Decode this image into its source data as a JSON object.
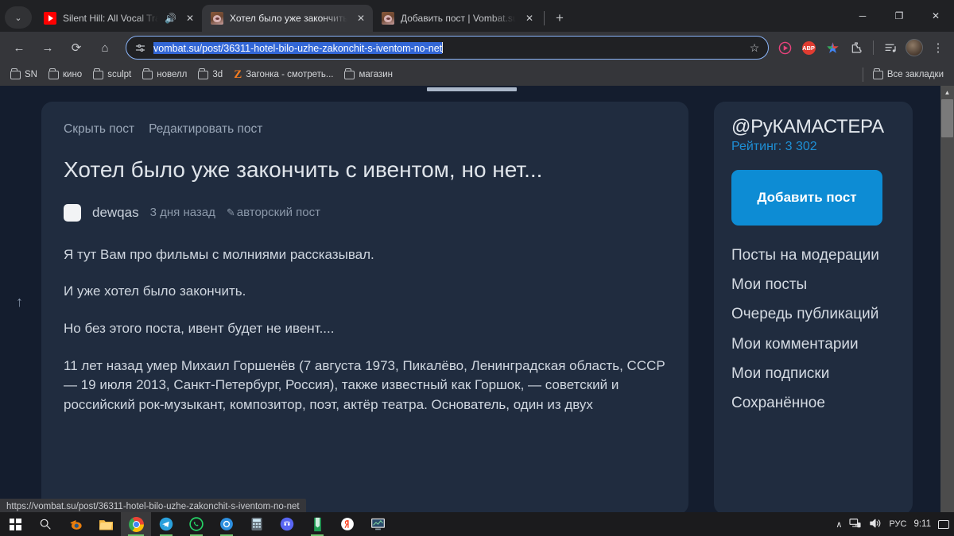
{
  "browser": {
    "tabs": [
      {
        "title": "Silent Hill: All Vocal Tracks -",
        "favicon": "youtube-icon",
        "audio": "audio-playing-icon",
        "active": false
      },
      {
        "title": "Хотел было уже закончить с и",
        "favicon": "vombat-icon",
        "audio": "",
        "active": true
      },
      {
        "title": "Добавить пост | Vombat.su",
        "favicon": "vombat-icon",
        "audio": "",
        "active": false
      }
    ],
    "new_tab_label": "+",
    "tab_close_label": "✕",
    "tab_list_chevron": "⌄",
    "window_controls": {
      "minimize": "─",
      "maximize": "❐",
      "close": "✕"
    },
    "nav": {
      "back": "←",
      "forward": "→",
      "reload": "⟳",
      "home": "⌂"
    },
    "omnibox": {
      "site_settings_icon": "tune-icon",
      "url_selected": "vombat.su/post/36311-hotel-bilo-uzhe-zakonchit-s-iventom-no-net",
      "bookmark_star": "☆"
    },
    "extensions": [
      {
        "name": "video-downloader-icon",
        "label": "▶"
      },
      {
        "name": "adblock-plus-icon",
        "label": "ABP"
      },
      {
        "name": "colorful-star-icon",
        "label": "✦"
      },
      {
        "name": "extensions-puzzle-icon",
        "label": "⧉"
      },
      {
        "name": "reading-list-icon",
        "label": "☰♪"
      }
    ],
    "profile_label": "",
    "menu_label": "⋮",
    "bookmarks": [
      {
        "label": "SN",
        "icon": "folder-icon"
      },
      {
        "label": "кино",
        "icon": "folder-icon"
      },
      {
        "label": "sculpt",
        "icon": "folder-icon"
      },
      {
        "label": "новелл",
        "icon": "folder-icon"
      },
      {
        "label": "3d",
        "icon": "folder-icon"
      },
      {
        "label": "Загонка - смотреть...",
        "icon": "zen-logo-icon"
      },
      {
        "label": "магазин",
        "icon": "folder-icon"
      }
    ],
    "bookmarks_all": {
      "label": "Все закладки",
      "icon": "folder-icon"
    },
    "status_url": "https://vombat.su/post/36311-hotel-bilo-uzhe-zakonchit-s-iventom-no-net"
  },
  "post": {
    "actions": [
      {
        "label": "Скрыть пост"
      },
      {
        "label": "Редактировать пост"
      }
    ],
    "title": "Хотел было уже закончить с ивентом, но нет...",
    "author": "dewqas",
    "date": "3 дня назад",
    "tag": "авторский пост",
    "tag_icon": "pencil-icon",
    "paragraphs": [
      "Я тут Вам про фильмы с молниями рассказывал.",
      "И уже хотел было закончить.",
      "Но без этого поста, ивент будет не ивент....",
      "11 лет назад умер Михаил Горшенёв (7 августа 1973, Пикалёво, Ленинградская область, СССР — 19 июля 2013, Санкт-Петербург, Россия), также известный как Горшок, — советский и российский рок-музыкант, композитор, поэт, актёр театра. Основатель, один из двух"
    ]
  },
  "sidebar": {
    "username": "@РуКАМАСТЕРА",
    "rating": "Рейтинг: 3 302",
    "add_post_button": "Добавить пост",
    "links": [
      {
        "label": "Посты на модерации"
      },
      {
        "label": "Мои посты"
      },
      {
        "label": "Очередь публикаций"
      },
      {
        "label": "Мои комментарии"
      },
      {
        "label": "Мои подписки"
      },
      {
        "label": "Сохранённое"
      }
    ]
  },
  "taskbar": {
    "items": [
      {
        "name": "start-button",
        "label": ""
      },
      {
        "name": "search-icon",
        "label": "○"
      },
      {
        "name": "blender-icon",
        "label": ""
      },
      {
        "name": "file-explorer-icon",
        "label": ""
      },
      {
        "name": "chrome-icon",
        "label": ""
      },
      {
        "name": "telegram-icon",
        "label": ""
      },
      {
        "name": "whatsapp-icon",
        "label": ""
      },
      {
        "name": "opera-icon",
        "label": ""
      },
      {
        "name": "calculator-icon",
        "label": ""
      },
      {
        "name": "discord-icon",
        "label": ""
      },
      {
        "name": "notepad-icon",
        "label": ""
      },
      {
        "name": "yandex-icon",
        "label": "Y"
      },
      {
        "name": "monitor-app-icon",
        "label": ""
      }
    ],
    "tray": {
      "chevron": "∧",
      "network_icon": "network-icon",
      "volume_icon": "volume-icon",
      "language": "РУС",
      "clock": "9:11",
      "notifications_icon": "notification-icon"
    }
  },
  "colors": {
    "page_bg": "#141d2e",
    "card_bg": "#202c3f",
    "accent_blue": "#0d8cd4",
    "rating_blue": "#1e8fd5",
    "chrome_toolbar": "#35363a",
    "chrome_tabstrip": "#202124",
    "selection_blue": "#3367d6"
  }
}
